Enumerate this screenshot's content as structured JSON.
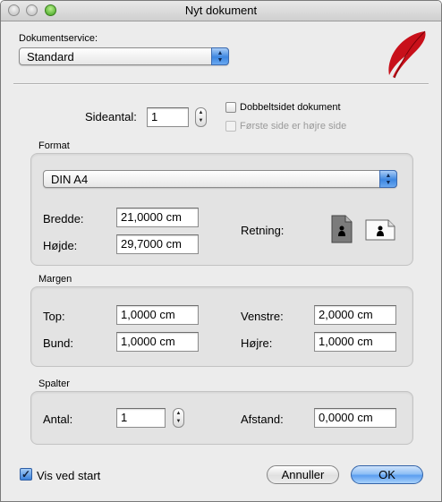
{
  "window": {
    "title": "Nyt dokument"
  },
  "document_service": {
    "label": "Dokumentservice:",
    "selected": "Standard"
  },
  "pages": {
    "label": "Sideantal:",
    "value": "1",
    "double_sided_label": "Dobbeltsidet dokument",
    "double_sided_checked": false,
    "first_page_right_label": "Første side er højre side",
    "first_page_right_checked": false
  },
  "format": {
    "title": "Format",
    "paper": "DIN A4",
    "width_label": "Bredde:",
    "width_value": "21,0000 cm",
    "height_label": "Højde:",
    "height_value": "29,7000 cm",
    "orientation_label": "Retning:",
    "orientation_selected": "portrait"
  },
  "margins": {
    "title": "Margen",
    "top_label": "Top:",
    "top_value": "1,0000 cm",
    "bottom_label": "Bund:",
    "bottom_value": "1,0000 cm",
    "left_label": "Venstre:",
    "left_value": "2,0000 cm",
    "right_label": "Højre:",
    "right_value": "1,0000 cm"
  },
  "columns": {
    "title": "Spalter",
    "count_label": "Antal:",
    "count_value": "1",
    "gap_label": "Afstand:",
    "gap_value": "0,0000 cm"
  },
  "footer": {
    "show_at_start_label": "Vis ved start",
    "show_at_start_checked": true,
    "cancel_label": "Annuller",
    "ok_label": "OK"
  },
  "icons": {
    "app_logo": "feather-quill-icon",
    "portrait": "portrait-page-icon",
    "landscape": "landscape-page-icon"
  },
  "colors": {
    "accent": "#3d86e0",
    "logo_red": "#c8101a"
  }
}
